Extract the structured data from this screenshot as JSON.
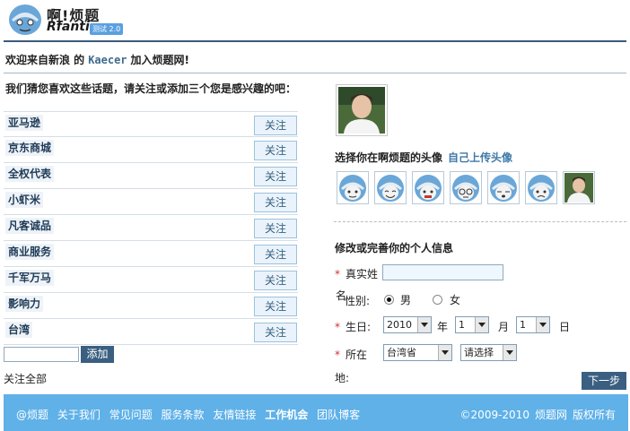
{
  "header": {
    "site_name": "啊!烦题",
    "site_name_en": "Rfanti",
    "badge": "测试 2.0"
  },
  "welcome": {
    "prefix": "欢迎来自新浪  的",
    "username": "Kaecer",
    "suffix": "加入烦题网!"
  },
  "topics": {
    "heading": "我们猜您喜欢这些话题，请关注或添加三个您是感兴趣的吧：",
    "follow_label": "关注",
    "items": [
      {
        "label": "亚马逊"
      },
      {
        "label": "京东商城"
      },
      {
        "label": "全权代表"
      },
      {
        "label": "小虾米"
      },
      {
        "label": "凡客诚品"
      },
      {
        "label": "商业服务"
      },
      {
        "label": "千军万马"
      },
      {
        "label": "影响力"
      },
      {
        "label": "台湾"
      }
    ],
    "add_input_value": "",
    "add_button": "添加",
    "follow_all": "关注全部"
  },
  "avatar": {
    "choose_heading": "选择你在啊烦题的头像",
    "upload_link": "自己上传头像",
    "options": [
      "default-face-icon",
      "smile-face-icon",
      "grin-face-icon",
      "glasses-face-icon",
      "ghost-face-icon",
      "sad-face-icon",
      "photo-avatar"
    ]
  },
  "profile": {
    "heading": "修改或完善你的个人信息",
    "name_label": "真实姓",
    "name_wrap": "名",
    "name_value": "",
    "gender_label": "性别:",
    "gender_male": "男",
    "gender_female": "女",
    "gender_selected": "男",
    "birthday_label": "生日:",
    "year_value": "2010",
    "year_unit": "年",
    "month_value": "1",
    "month_unit": "月",
    "day_value": "1",
    "day_unit": "日",
    "location_label": "所在",
    "location_wrap": "地:",
    "province_value": "台湾省",
    "city_value": "请选择",
    "required_mark": "*",
    "next_button": "下一步"
  },
  "footer": {
    "links": [
      "@烦题",
      "关于我们",
      "常见问题",
      "服务条款",
      "友情链接",
      "工作机会",
      "团队博客"
    ],
    "bold_link": "工作机会",
    "copyright": "©2009-2010",
    "site": "烦题网",
    "rights": "版权所有"
  },
  "colors": {
    "accent": "#3a5f80",
    "link": "#3f79a8",
    "footer_bg": "#5fb1e8",
    "required": "#d03030"
  }
}
